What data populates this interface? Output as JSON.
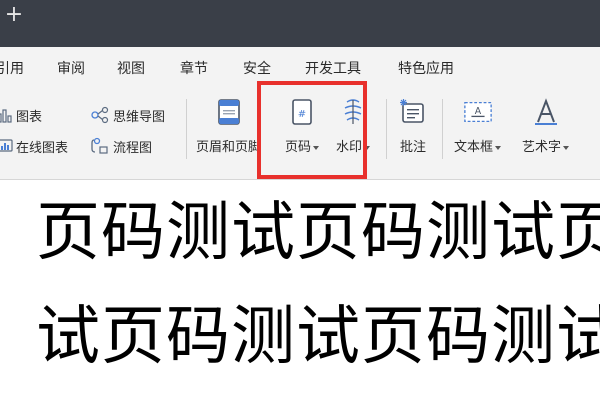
{
  "titlebar": {
    "new_tab_symbol": "+"
  },
  "menu": {
    "items": [
      "引用",
      "审阅",
      "视图",
      "章节",
      "安全",
      "开发工具",
      "特色应用"
    ]
  },
  "ribbon": {
    "chart": "图表",
    "mindmap": "思维导图",
    "online_chart": "在线图表",
    "flowchart": "流程图",
    "header_footer": "页眉和页脚",
    "page_number": "页码",
    "watermark": "水印",
    "comment": "批注",
    "textbox": "文本框",
    "wordart": "艺术字"
  },
  "document": {
    "line1": "页码测试页码测试页",
    "line2": "试页码测试页码测试"
  },
  "colors": {
    "highlight": "#e8302c",
    "titlebar": "#3a3f48",
    "ribbon": "#f3f3f3",
    "accent": "#4a7fd4"
  }
}
